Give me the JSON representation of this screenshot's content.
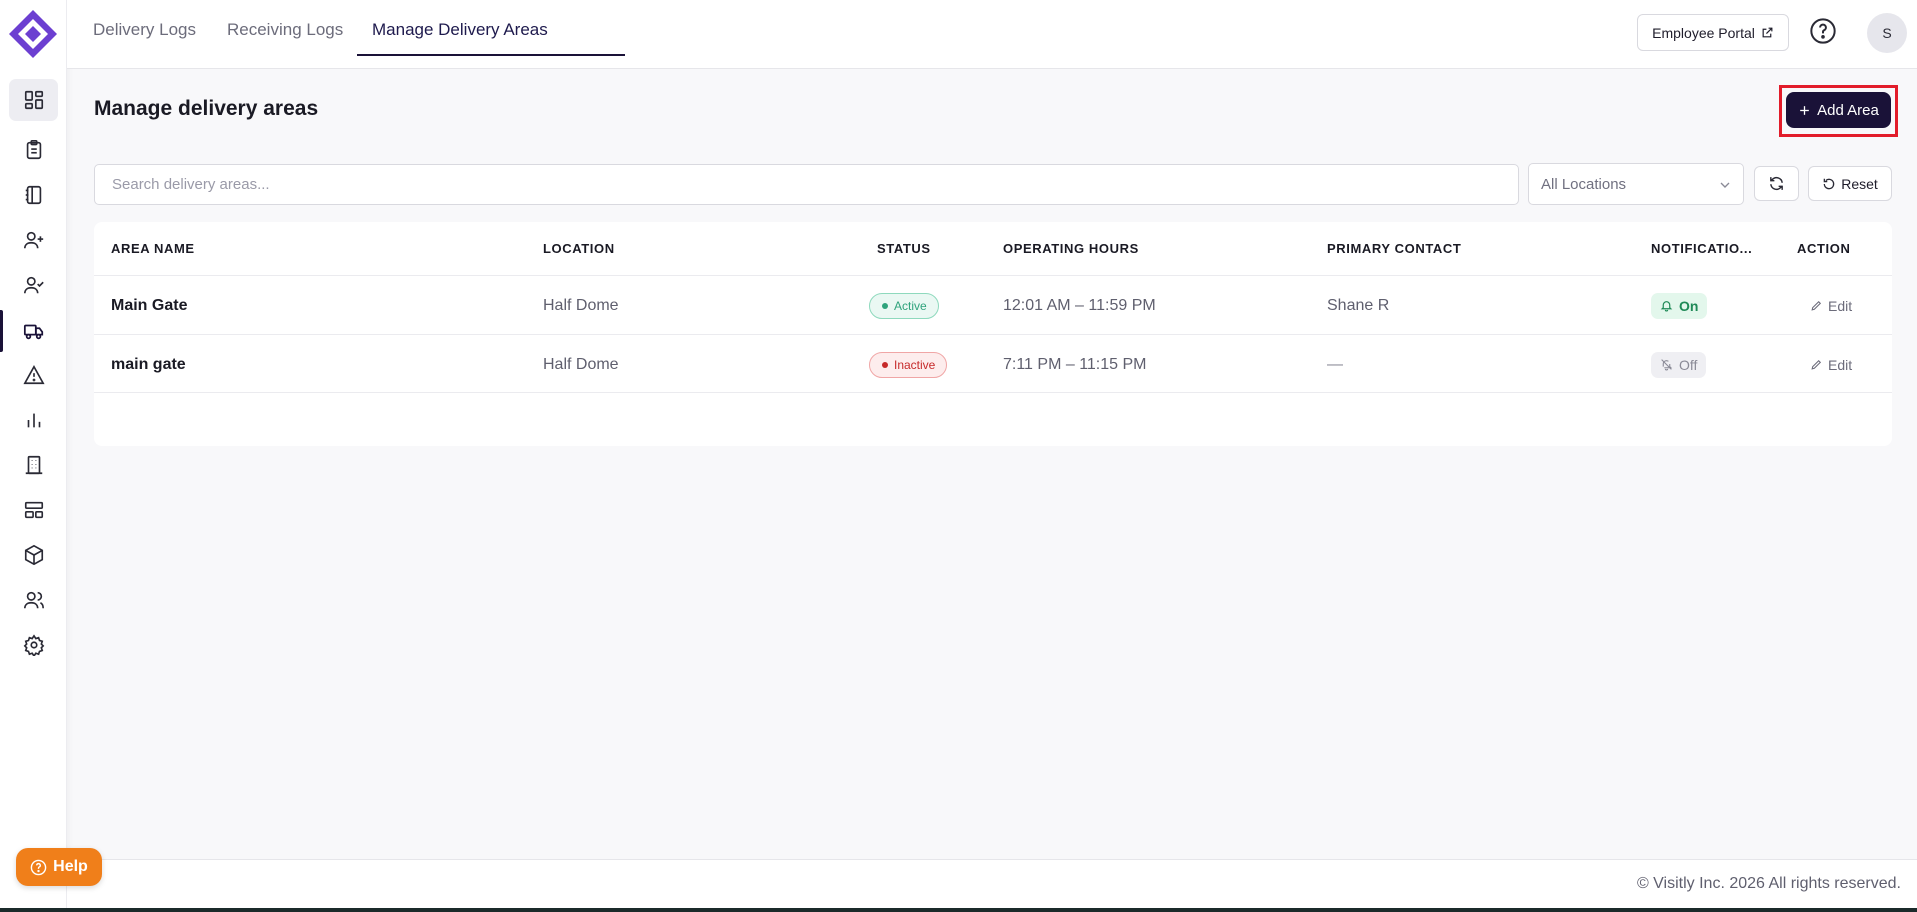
{
  "header": {
    "tabs": [
      {
        "label": "Delivery Logs"
      },
      {
        "label": "Receiving Logs"
      },
      {
        "label": "Manage Delivery Areas"
      }
    ],
    "employee_portal_label": "Employee Portal",
    "avatar_initial": "S"
  },
  "sidebar": {
    "items": [
      {
        "icon": "dashboard-icon"
      },
      {
        "icon": "clipboard-icon"
      },
      {
        "icon": "logbook-icon"
      },
      {
        "icon": "user-plus-icon"
      },
      {
        "icon": "user-check-icon"
      },
      {
        "icon": "truck-icon",
        "active": true
      },
      {
        "icon": "warning-icon"
      },
      {
        "icon": "bar-chart-icon"
      },
      {
        "icon": "building-icon"
      },
      {
        "icon": "layout-icon"
      },
      {
        "icon": "package-icon"
      },
      {
        "icon": "users-icon"
      },
      {
        "icon": "settings-icon"
      }
    ]
  },
  "main": {
    "title": "Manage delivery areas",
    "add_button_label": "Add Area",
    "search_placeholder": "Search delivery areas...",
    "location_filter_value": "All Locations",
    "reset_label": "Reset"
  },
  "table": {
    "headers": [
      "AREA NAME",
      "LOCATION",
      "STATUS",
      "OPERATING HOURS",
      "PRIMARY CONTACT",
      "NOTIFICATIO...",
      "ACTION"
    ],
    "rows": [
      {
        "area_name": "Main Gate",
        "location": "Half Dome",
        "status": "Active",
        "hours": "12:01 AM – 11:59 PM",
        "contact": "Shane R",
        "notifications": "On",
        "action": "Edit"
      },
      {
        "area_name": "main gate",
        "location": "Half Dome",
        "status": "Inactive",
        "hours": "7:11 PM – 11:15 PM",
        "contact": "—",
        "notifications": "Off",
        "action": "Edit"
      }
    ]
  },
  "footer": {
    "copyright": "© Visitly Inc. 2026 All rights reserved.",
    "help_label": "Help"
  },
  "colors": {
    "brand": "#6c3fd1",
    "primary_button": "#1a1238",
    "highlight_outline": "#e21c2a",
    "help_button": "#f07f1a",
    "active_status": "#2fa37c",
    "inactive_status": "#c62a2a"
  }
}
